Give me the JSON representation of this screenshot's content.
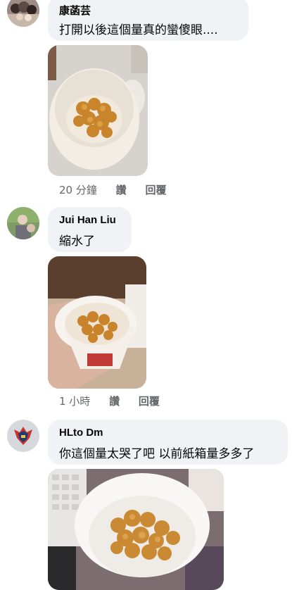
{
  "comments": [
    {
      "author": "康菡芸",
      "text": "打開以後這個量真的蠻傻眼....",
      "time": "",
      "like": "",
      "reply": ""
    },
    {
      "author": "",
      "text": "",
      "time": "20 分鐘",
      "like": "讚",
      "reply": "回覆"
    },
    {
      "author": "Jui Han Liu",
      "text": "縮水了",
      "time": "1 小時",
      "like": "讚",
      "reply": "回覆"
    },
    {
      "author": "HLto Dm",
      "text": "你這個量太哭了吧 以前紙箱量多多了",
      "time": "",
      "like": "",
      "reply": ""
    }
  ],
  "colors": {
    "bubble": "#f0f2f5",
    "meta": "#65676b",
    "text": "#050505"
  }
}
